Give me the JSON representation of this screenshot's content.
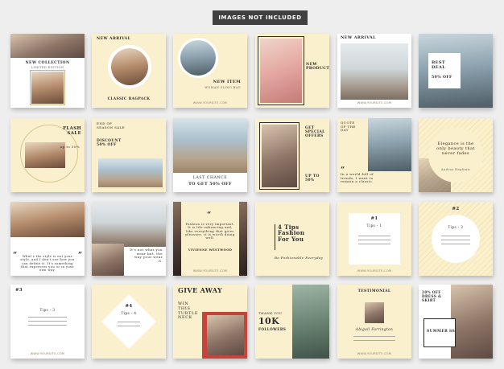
{
  "banner": "IMAGES NOT INCLUDED",
  "colors": {
    "cream": "#fbf0cd",
    "ink": "#2b2b2b",
    "page": "#eeeeee"
  },
  "site": "WWW.YOURSITE.COM",
  "r1": {
    "t1": {
      "title": "NEW COLLECTION",
      "sub": "LIMITED EDITION"
    },
    "t2": {
      "top": "NEW ARRIVAL",
      "bottom": "CLASSIC BAGPACK"
    },
    "t3": {
      "title": "NEW ITEM",
      "sub": "WOMAN SLING BAG"
    },
    "t4": {
      "title": "NEW PRODUCT"
    },
    "t5": {
      "title": "NEW ARRIVAL"
    },
    "t6": {
      "title": "BEST DEAL",
      "sub": "50% OFF"
    }
  },
  "r2": {
    "t1": {
      "title": "FLASH SALE",
      "sub": "up to 50%"
    },
    "t2": {
      "a": "END OF SEASON SALE",
      "b": "DISCOUNT 50% OFF"
    },
    "t3": {
      "a": "LAST CHANCE",
      "b": "TO GET 50% OFF"
    },
    "t4": {
      "a": "GET SPECIAL OFFERS",
      "b": "UP TO 50%"
    },
    "t5": {
      "a": "QUOTE OF THE DAY",
      "b": "In a world full of trends, I want to remain a classic."
    },
    "t6": {
      "a": "Elegance is the only beauty that never fades",
      "b": "Audrey Hepburn"
    }
  },
  "r3": {
    "t1": {
      "a": "What's the style is not your style, and I don't see how you can define it. It's something that expresses you or in your own way."
    },
    "t2": {
      "a": "It's not what you wear but, the way your wear it."
    },
    "t3": {
      "a": "Fashion is very important. It is life-enhancing and, like everything that gives pleasure, it is worth doing well.",
      "b": "VIVIENNE WESTWOOD"
    },
    "t4": {
      "a": "4 Tips Fashion For You",
      "b": "Be Fashionable Everyday"
    },
    "t5": {
      "num": "#1",
      "label": "Tips - 1"
    },
    "t6": {
      "num": "#2",
      "label": "Tips - 2"
    }
  },
  "r4": {
    "t1": {
      "num": "#3",
      "label": "Tips - 3"
    },
    "t2": {
      "num": "#4",
      "label": "Tips - 4"
    },
    "t3": {
      "a": "GIVE AWAY",
      "b": "WIN THIS TURTLE NECK"
    },
    "t4": {
      "a": "THANK YOU",
      "b": "10K",
      "c": "FOLLOWERS"
    },
    "t5": {
      "a": "TESTIMONIAL",
      "b": "Abigail Farrington"
    },
    "t6": {
      "a": "20% OFF DRESS & SKIRT",
      "b": "SUMMER SS"
    }
  }
}
